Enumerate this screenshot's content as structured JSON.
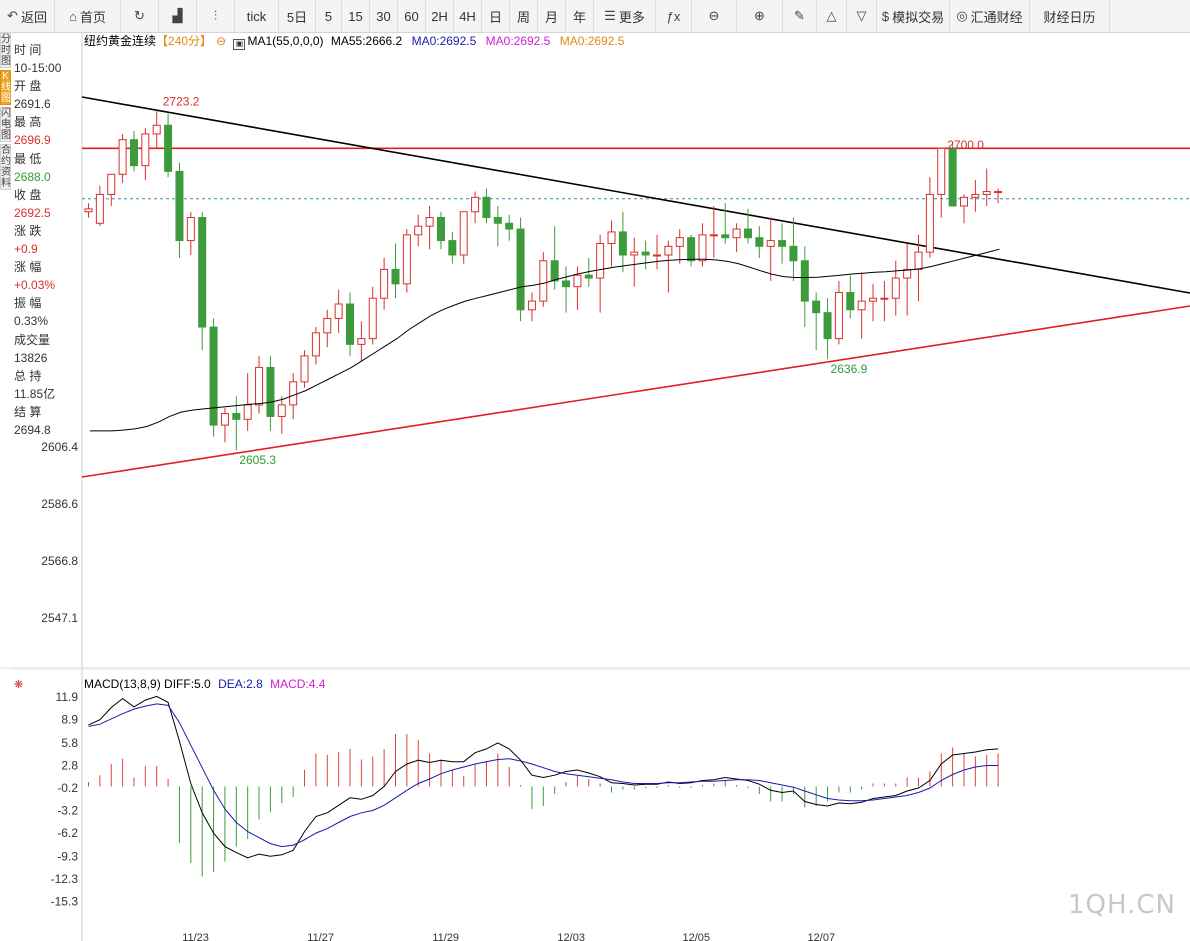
{
  "toolbar": {
    "items": [
      {
        "name": "back-button",
        "icon": "arrow-left",
        "label": "返回",
        "w": 55
      },
      {
        "name": "home-button",
        "icon": "home",
        "label": "首页",
        "w": 66
      },
      {
        "name": "refresh-button",
        "icon": "refresh",
        "label": "",
        "w": 38
      },
      {
        "name": "kline-button",
        "icon": "kline",
        "label": "",
        "w": 38
      },
      {
        "name": "candle-button",
        "icon": "candle",
        "label": "",
        "w": 38
      },
      {
        "name": "tick-button",
        "icon": "",
        "label": "tick",
        "w": 44
      },
      {
        "name": "period-5day",
        "icon": "",
        "label": "5日",
        "w": 37
      },
      {
        "name": "period-5",
        "icon": "",
        "label": "5",
        "w": 26
      },
      {
        "name": "period-15",
        "icon": "",
        "label": "15",
        "w": 28
      },
      {
        "name": "period-30",
        "icon": "",
        "label": "30",
        "w": 28
      },
      {
        "name": "period-60",
        "icon": "",
        "label": "60",
        "w": 28
      },
      {
        "name": "period-2h",
        "icon": "",
        "label": "2H",
        "w": 28
      },
      {
        "name": "period-4h",
        "icon": "",
        "label": "4H",
        "w": 28
      },
      {
        "name": "period-day",
        "icon": "",
        "label": "日",
        "w": 28
      },
      {
        "name": "period-week",
        "icon": "",
        "label": "周",
        "w": 28
      },
      {
        "name": "period-month",
        "icon": "",
        "label": "月",
        "w": 28
      },
      {
        "name": "period-year",
        "icon": "",
        "label": "年",
        "w": 28
      },
      {
        "name": "more-button",
        "icon": "menu",
        "label": "更多",
        "w": 62
      },
      {
        "name": "formula-button",
        "icon": "fx",
        "label": "",
        "w": 36
      },
      {
        "name": "zoom-out-button",
        "icon": "zoom-out",
        "label": "",
        "w": 45
      },
      {
        "name": "zoom-in-button",
        "icon": "zoom-in",
        "label": "",
        "w": 46
      },
      {
        "name": "draw-button",
        "icon": "pencil",
        "label": "",
        "w": 34
      },
      {
        "name": "triangle-up-button",
        "icon": "triangle-up",
        "label": "",
        "w": 30
      },
      {
        "name": "triangle-down-button",
        "icon": "triangle-down",
        "label": "",
        "w": 30
      },
      {
        "name": "sim-trade-button",
        "icon": "dollar",
        "label": "模拟交易",
        "w": 73
      },
      {
        "name": "huitong-button",
        "icon": "swirl",
        "label": "汇通财经",
        "w": 80
      },
      {
        "name": "calendar-button",
        "icon": "",
        "label": "财经日历",
        "w": 80
      }
    ]
  },
  "sidebar_tabs": [
    {
      "label": "分时图",
      "active": false
    },
    {
      "label": "K线图",
      "active": true
    },
    {
      "label": "闪电图",
      "active": false
    },
    {
      "label": "合约资料",
      "active": false
    }
  ],
  "info": [
    {
      "label": "时 间",
      "value": "10-15:00",
      "color": "#333333"
    },
    {
      "label": "开 盘",
      "value": "2691.6",
      "color": "#333333"
    },
    {
      "label": "最 高",
      "value": "2696.9",
      "color": "#d9302c"
    },
    {
      "label": "最 低",
      "value": "2688.0",
      "color": "#2e9c33"
    },
    {
      "label": "收 盘",
      "value": "2692.5",
      "color": "#d9302c"
    },
    {
      "label": "涨 跌",
      "value": "+0.9",
      "color": "#d9302c"
    },
    {
      "label": "涨 幅",
      "value": "+0.03%",
      "color": "#d9302c"
    },
    {
      "label": "振 幅",
      "value": "0.33%",
      "color": "#333333"
    },
    {
      "label": "成交量",
      "value": "13826",
      "color": "#333333"
    },
    {
      "label": "总 持",
      "value": "11.85亿",
      "color": "#333333"
    },
    {
      "label": "结 算",
      "value": "2694.8",
      "color": "#333333"
    }
  ],
  "legend": {
    "symbol": "纽约黄金连续",
    "period": "【240分】",
    "ma1": "MA1(55,0,0,0)",
    "ma55": "MA55:2666.2",
    "ma0a": "MA0:2692.5",
    "ma0b": "MA0:2692.5",
    "ma0c": "MA0:2692.5",
    "colors": {
      "ma55": "#000000",
      "ma0a": "#1a1ab0",
      "ma0b": "#d020d0",
      "ma0c": "#e08a10"
    }
  },
  "macd_legend": {
    "name": "MACD(13,8,9)",
    "diff": "DIFF:5.0",
    "dea": "DEA:2.8",
    "macd": "MACD:4.4"
  },
  "chart_data": {
    "type": "candlestick",
    "price_axis_ticks": [
      "2606.4",
      "2586.6",
      "2566.8",
      "2547.1"
    ],
    "macd_axis_ticks": [
      "11.9",
      "8.9",
      "5.8",
      "2.8",
      "-0.2",
      "-3.2",
      "-6.2",
      "-9.3",
      "-12.3",
      "-15.3"
    ],
    "date_labels": [
      "11/23",
      "11/27",
      "11/29",
      "12/03",
      "12/05",
      "12/07"
    ],
    "annotations": [
      {
        "text": "2723.2",
        "color": "red"
      },
      {
        "text": "2700.0",
        "color": "red"
      },
      {
        "text": "2605.3",
        "color": "green"
      },
      {
        "text": "2636.9",
        "color": "green"
      }
    ],
    "horizontal_line": 2710.0,
    "last_close_line": 2692.5,
    "candles": [
      [
        2688,
        2691,
        2686,
        2689
      ],
      [
        2684,
        2697,
        2683,
        2694
      ],
      [
        2694,
        2701,
        2690,
        2701
      ],
      [
        2701,
        2715,
        2698,
        2713
      ],
      [
        2713,
        2716,
        2702,
        2704
      ],
      [
        2704,
        2717,
        2699,
        2715
      ],
      [
        2715,
        2723.2,
        2710,
        2718
      ],
      [
        2718,
        2722,
        2700,
        2702
      ],
      [
        2702,
        2705,
        2672,
        2678
      ],
      [
        2678,
        2688,
        2673,
        2686
      ],
      [
        2686,
        2688,
        2640,
        2648
      ],
      [
        2648,
        2651,
        2610,
        2614
      ],
      [
        2614,
        2620,
        2608,
        2618
      ],
      [
        2618,
        2624,
        2605.3,
        2616
      ],
      [
        2616,
        2632,
        2612,
        2621
      ],
      [
        2621,
        2638,
        2618,
        2634
      ],
      [
        2634,
        2638,
        2612,
        2617
      ],
      [
        2617,
        2624,
        2611,
        2621
      ],
      [
        2621,
        2632,
        2616,
        2629
      ],
      [
        2629,
        2640,
        2627,
        2638
      ],
      [
        2638,
        2648,
        2635,
        2646
      ],
      [
        2646,
        2654,
        2641,
        2651
      ],
      [
        2651,
        2661,
        2646,
        2656
      ],
      [
        2656,
        2660,
        2638,
        2642
      ],
      [
        2642,
        2650,
        2636,
        2644
      ],
      [
        2644,
        2662,
        2642,
        2658
      ],
      [
        2658,
        2672,
        2654,
        2668
      ],
      [
        2668,
        2677,
        2658,
        2663
      ],
      [
        2663,
        2682,
        2660,
        2680
      ],
      [
        2680,
        2687,
        2676,
        2683
      ],
      [
        2683,
        2690,
        2675,
        2686
      ],
      [
        2686,
        2688,
        2675,
        2678
      ],
      [
        2678,
        2681,
        2670,
        2673
      ],
      [
        2673,
        2688,
        2670,
        2688
      ],
      [
        2688,
        2695,
        2684,
        2693
      ],
      [
        2693,
        2696,
        2684,
        2686
      ],
      [
        2686,
        2690,
        2676,
        2684
      ],
      [
        2684,
        2687,
        2678,
        2682
      ],
      [
        2682,
        2686,
        2650,
        2654
      ],
      [
        2654,
        2660,
        2650,
        2657
      ],
      [
        2657,
        2674,
        2655,
        2671
      ],
      [
        2671,
        2683,
        2661,
        2664
      ],
      [
        2664,
        2669,
        2653,
        2662
      ],
      [
        2662,
        2669,
        2654,
        2666
      ],
      [
        2666,
        2672,
        2662,
        2665
      ],
      [
        2665,
        2680,
        2653,
        2677
      ],
      [
        2677,
        2685,
        2669,
        2681
      ],
      [
        2681,
        2688,
        2667,
        2673
      ],
      [
        2673,
        2679,
        2662,
        2674
      ],
      [
        2674,
        2678,
        2668,
        2673
      ],
      [
        2673,
        2680,
        2668,
        2673
      ],
      [
        2673,
        2678,
        2660,
        2676
      ],
      [
        2676,
        2682,
        2670,
        2679
      ],
      [
        2679,
        2680,
        2669,
        2671
      ],
      [
        2671,
        2684,
        2669,
        2680
      ],
      [
        2680,
        2690,
        2672,
        2680
      ],
      [
        2680,
        2691,
        2677,
        2679
      ],
      [
        2679,
        2684,
        2674,
        2682
      ],
      [
        2682,
        2689,
        2677,
        2679
      ],
      [
        2679,
        2683,
        2672,
        2676
      ],
      [
        2676,
        2686,
        2664,
        2678
      ],
      [
        2678,
        2684,
        2670,
        2676
      ],
      [
        2676,
        2686,
        2664,
        2671
      ],
      [
        2671,
        2676,
        2648,
        2657
      ],
      [
        2657,
        2660,
        2640,
        2653
      ],
      [
        2653,
        2658,
        2636.9,
        2644
      ],
      [
        2644,
        2664,
        2642,
        2660
      ],
      [
        2660,
        2666,
        2651,
        2654
      ],
      [
        2654,
        2667,
        2644,
        2657
      ],
      [
        2657,
        2663,
        2650,
        2658
      ],
      [
        2658,
        2664,
        2650,
        2658
      ],
      [
        2658,
        2671,
        2652,
        2665
      ],
      [
        2665,
        2677,
        2652,
        2668
      ],
      [
        2668,
        2680,
        2657,
        2674
      ],
      [
        2674,
        2700,
        2672,
        2694
      ],
      [
        2694,
        2708,
        2686,
        2710
      ],
      [
        2710,
        2712,
        2692,
        2690
      ],
      [
        2690,
        2694,
        2684,
        2693
      ],
      [
        2693,
        2699,
        2688,
        2694
      ],
      [
        2694,
        2703,
        2690,
        2695
      ],
      [
        2695,
        2696,
        2691,
        2695
      ]
    ],
    "ma55": [
      2612,
      2612,
      2612,
      2612.3,
      2612.7,
      2613.5,
      2615,
      2617,
      2618.5,
      2619.2,
      2619.6,
      2620,
      2620.4,
      2620.8,
      2621.2,
      2621.5,
      2622,
      2623,
      2624.5,
      2626,
      2628,
      2630,
      2632,
      2634,
      2636.5,
      2639,
      2641.5,
      2644,
      2647,
      2649.5,
      2652,
      2654,
      2655.5,
      2657,
      2658,
      2659,
      2660,
      2661,
      2662,
      2662.5,
      2663.3,
      2664.5,
      2665.5,
      2666.5,
      2667.3,
      2668,
      2668.7,
      2669.3,
      2669.8,
      2670.3,
      2670.8,
      2671.2,
      2671.4,
      2671.5,
      2671.5,
      2671.3,
      2670.8,
      2670,
      2668.8,
      2667.5,
      2666.3,
      2665.5,
      2665.2,
      2665.2,
      2665.3,
      2665.6,
      2666,
      2666.4,
      2666.7,
      2667,
      2667.2,
      2667.5,
      2667.8,
      2668.2,
      2669,
      2670,
      2671,
      2672,
      2673,
      2674,
      2675
    ],
    "diff": [
      8.2,
      8.9,
      10.5,
      11.7,
      10.6,
      11.5,
      12,
      11.2,
      6,
      0.4,
      -3.5,
      -6.2,
      -8,
      -8.8,
      -9.5,
      -9,
      -9.3,
      -9.1,
      -8.5,
      -6,
      -4,
      -3.5,
      -2.5,
      -1.5,
      -1.7,
      -1.2,
      0,
      2,
      3,
      3.5,
      3.2,
      3.5,
      3.3,
      3.3,
      4.5,
      5,
      5.8,
      5,
      3.5,
      1.5,
      1.2,
      1.5,
      2,
      2.2,
      1.8,
      1.3,
      0.5,
      0.4,
      0.2,
      0.3,
      0.3,
      0.6,
      0.4,
      0.5,
      0.8,
      0.9,
      1.2,
      1,
      0.8,
      0.3,
      -0.5,
      -0.8,
      -0.6,
      -2,
      -2.4,
      -2.6,
      -2.2,
      -2.3,
      -2.1,
      -1.6,
      -1.4,
      -1.2,
      -0.6,
      -0.2,
      0.8,
      3,
      4.2,
      4.4,
      4.6,
      4.9,
      5
    ],
    "dea": [
      8,
      8.3,
      9,
      9.7,
      10.3,
      10.7,
      11,
      10.8,
      8.5,
      5.5,
      2.5,
      -0.5,
      -3,
      -4.8,
      -6,
      -6.8,
      -7.6,
      -8,
      -7.8,
      -7.1,
      -6.2,
      -5.6,
      -4.8,
      -4,
      -3.5,
      -3.2,
      -2.5,
      -1.5,
      -0.5,
      0.4,
      1,
      1.7,
      2.2,
      2.6,
      3,
      3.3,
      3.6,
      3.7,
      3.4,
      3,
      2.5,
      2,
      1.7,
      1.5,
      1.3,
      1.1,
      0.9,
      0.6,
      0.4,
      0.4,
      0.4,
      0.5,
      0.5,
      0.6,
      0.7,
      0.7,
      0.8,
      0.9,
      0.9,
      0.8,
      0.5,
      0.2,
      -0.1,
      -0.6,
      -1.1,
      -1.6,
      -1.8,
      -1.9,
      -1.9,
      -1.8,
      -1.6,
      -1.4,
      -1.2,
      -0.8,
      -0.2,
      0.8,
      1.6,
      2.2,
      2.6,
      2.8,
      2.8
    ],
    "macd": [
      0.6,
      1.5,
      3,
      3.7,
      1.2,
      2.7,
      2.7,
      1,
      -7.5,
      -10.2,
      -12,
      -11.4,
      -10,
      -8,
      -7,
      -4.4,
      -3.4,
      -2.2,
      -1.4,
      2.2,
      4.4,
      4.2,
      4.6,
      5,
      3.6,
      4,
      5,
      7,
      7,
      6.2,
      4.4,
      3.6,
      2.2,
      1.4,
      3,
      3.4,
      4.4,
      2.6,
      0.2,
      -3,
      -2.6,
      -1,
      0.6,
      1.4,
      1,
      0.4,
      -0.8,
      -0.4,
      -0.4,
      -0.2,
      -0.2,
      0.2,
      -0.2,
      -0.2,
      0.2,
      0.4,
      0.8,
      0.2,
      -0.2,
      -1,
      -2,
      -2,
      -1,
      -2.8,
      -2.6,
      -2,
      -0.8,
      -0.8,
      -0.4,
      0.4,
      0.4,
      0.4,
      1.2,
      1.2,
      2,
      4.4,
      5.2,
      4.4,
      4,
      4.2,
      4.4
    ]
  }
}
